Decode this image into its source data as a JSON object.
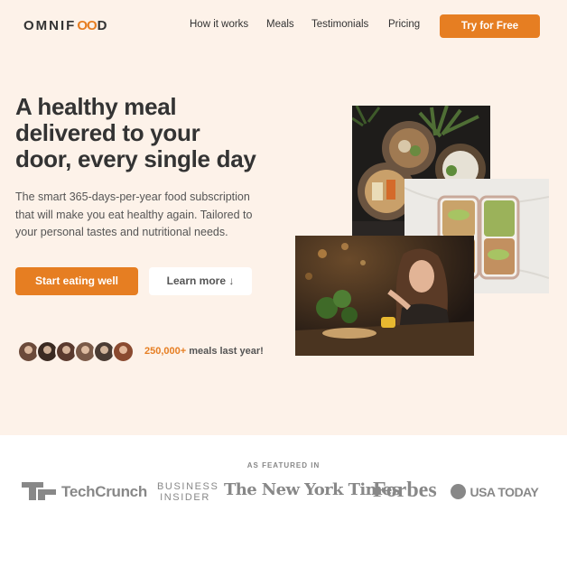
{
  "header": {
    "logo_pre": "OMNIF",
    "logo_oo": "OO",
    "logo_post": "D",
    "nav": [
      "How it works",
      "Meals",
      "Testimonials",
      "Pricing"
    ],
    "cta": "Try for Free"
  },
  "hero": {
    "title_lines": [
      "A healthy meal",
      "delivered to your",
      "door, every single day"
    ],
    "description_lines": [
      "The smart 365-days-per-year food subscription",
      "that will make you eat healthy again. Tailored to",
      "your personal tastes and nutritional needs."
    ],
    "primary_button": "Start eating well",
    "secondary_button": "Learn more ↓",
    "meals_count": "250,000+",
    "meals_text": " meals last year!"
  },
  "featured": {
    "label": "AS FEATURED IN",
    "logos": [
      "TechCrunch",
      "BUSINESS",
      "INSIDER",
      "The New York Times",
      "Forbes",
      "USA TODAY"
    ]
  },
  "colors": {
    "accent": "#e67e22",
    "hero_bg": "#fdf2e9",
    "text": "#333333"
  }
}
